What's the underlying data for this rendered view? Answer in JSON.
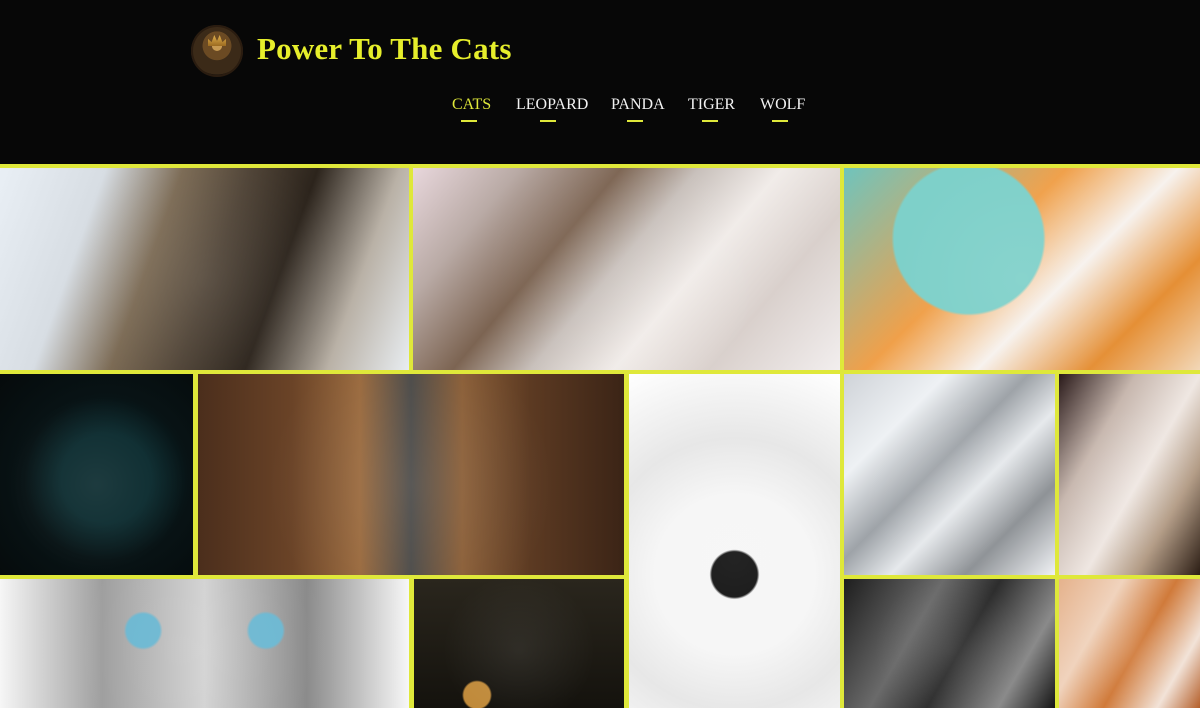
{
  "site": {
    "title": "Power To The Cats",
    "logo_icon": "crown-cat-logo-icon"
  },
  "nav": {
    "items": [
      {
        "label": "CATS",
        "active": true
      },
      {
        "label": "LEOPARD",
        "active": false
      },
      {
        "label": "PANDA",
        "active": false
      },
      {
        "label": "TIGER",
        "active": false
      },
      {
        "label": "WOLF",
        "active": false
      }
    ]
  },
  "colors": {
    "accent": "#dfe83a",
    "background": "#070707"
  },
  "gallery": {
    "tiles": [
      {
        "name": "tabby-cat-photo"
      },
      {
        "name": "kitten-paws-photo"
      },
      {
        "name": "orange-white-cat-licking-photo"
      },
      {
        "name": "black-cat-eyes-photo"
      },
      {
        "name": "grey-kitten-standing-photo"
      },
      {
        "name": "black-white-cat-in-blanket-photo"
      },
      {
        "name": "silver-tabby-kitten-photo"
      },
      {
        "name": "white-kitten-photo"
      },
      {
        "name": "blue-eyes-cat-closeup-photo"
      },
      {
        "name": "crown-ornament-photo"
      },
      {
        "name": "grey-tabby-cat-photo"
      },
      {
        "name": "orange-cat-photo"
      }
    ]
  }
}
